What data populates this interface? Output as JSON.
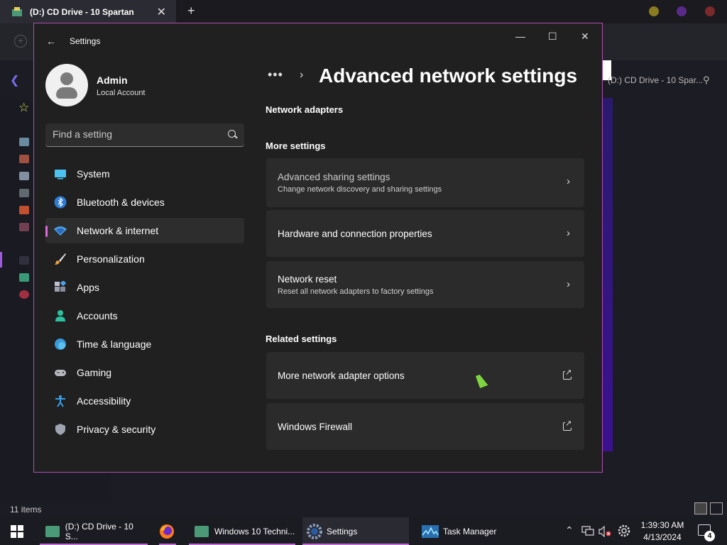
{
  "explorer": {
    "tab_title": "(D:) CD Drive - 10 Spartan",
    "tab_close": "✕",
    "new_tab": "+",
    "address": "(D:) CD Drive - 10 Spar...",
    "status": "11 items"
  },
  "settings": {
    "window_title": "Settings",
    "back": "←",
    "minimize": "—",
    "maximize": "☐",
    "close": "✕",
    "user": {
      "name": "Admin",
      "account_type": "Local Account"
    },
    "search": {
      "placeholder": "Find a setting"
    },
    "nav": [
      {
        "label": "System",
        "icon": "system-icon"
      },
      {
        "label": "Bluetooth & devices",
        "icon": "bluetooth-icon"
      },
      {
        "label": "Network & internet",
        "icon": "network-icon",
        "active": true
      },
      {
        "label": "Personalization",
        "icon": "brush-icon"
      },
      {
        "label": "Apps",
        "icon": "apps-icon"
      },
      {
        "label": "Accounts",
        "icon": "accounts-icon"
      },
      {
        "label": "Time & language",
        "icon": "globe-icon"
      },
      {
        "label": "Gaming",
        "icon": "gamepad-icon"
      },
      {
        "label": "Accessibility",
        "icon": "accessibility-icon"
      },
      {
        "label": "Privacy & security",
        "icon": "shield-icon"
      }
    ],
    "breadcrumb": {
      "dots": "•••",
      "separator": "›"
    },
    "page_title": "Advanced network settings",
    "sections": {
      "network_adapters": "Network adapters",
      "more_settings": "More settings",
      "related_settings": "Related settings"
    },
    "more_cards": [
      {
        "title": "Advanced sharing settings",
        "subtitle": "Change network discovery and sharing settings"
      },
      {
        "title": "Hardware and connection properties"
      },
      {
        "title": "Network reset",
        "subtitle": "Reset all network adapters to factory settings"
      }
    ],
    "related_cards": [
      {
        "title": "More network adapter options"
      },
      {
        "title": "Windows Firewall"
      }
    ],
    "chevron": "›"
  },
  "taskbar": {
    "items": [
      {
        "label": "(D:) CD Drive - 10 S..."
      },
      {
        "label": "Windows 10 Techni..."
      },
      {
        "label": "Settings"
      },
      {
        "label": "Task Manager"
      }
    ],
    "time": "1:39:30 AM",
    "date": "4/13/2024",
    "notification_count": "4",
    "tray_chevron": "⌃"
  },
  "colors": {
    "accent_pink": "#e06ad8",
    "window_border": "#b04fb0",
    "card_bg": "#2b2b2b",
    "settings_bg": "#202020"
  }
}
